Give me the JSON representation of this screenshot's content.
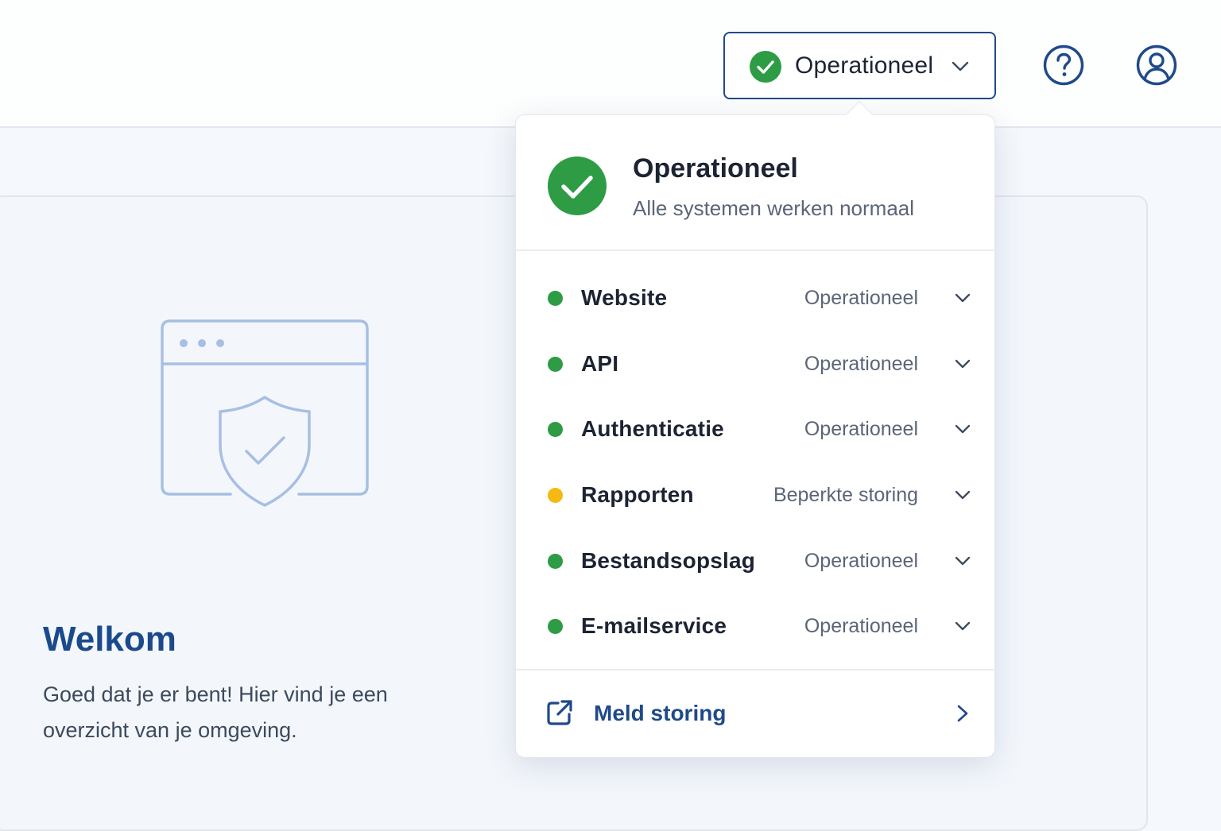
{
  "header": {
    "status_button_label": "Operationeel",
    "help_icon": "question-circle-icon",
    "user_icon": "user-circle-icon"
  },
  "welcome": {
    "title": "Welkom",
    "text": "Goed dat je er bent! Hier vind je een overzicht van je omgeving.",
    "illustration_icon": "browser-shield-check-icon"
  },
  "status_popover": {
    "title": "Operationeel",
    "subtitle": "Alle systemen werken normaal",
    "services": [
      {
        "name": "Website",
        "status": "Operationeel",
        "color": "#2e9b45"
      },
      {
        "name": "API",
        "status": "Operationeel",
        "color": "#2e9b45"
      },
      {
        "name": "Authenticatie",
        "status": "Operationeel",
        "color": "#2e9b45"
      },
      {
        "name": "Rapporten",
        "status": "Beperkte storing",
        "color": "#f5b912"
      },
      {
        "name": "Bestandsopslag",
        "status": "Operationeel",
        "color": "#2e9b45"
      },
      {
        "name": "E-mailservice",
        "status": "Operationeel",
        "color": "#2e9b45"
      }
    ],
    "report_link": "Meld storing"
  },
  "colors": {
    "accent": "#1f4a8a",
    "ok": "#2e9b45",
    "warning": "#f5b912"
  }
}
